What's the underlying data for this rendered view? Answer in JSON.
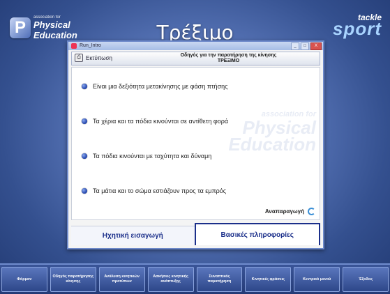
{
  "header": {
    "logo_left": {
      "line1": "association for",
      "line2": "Physical",
      "line3": "Education"
    },
    "title": "Τρέξιμο",
    "logo_right": {
      "line1": "tackle",
      "line2": "sport"
    }
  },
  "window": {
    "title": "Run_Intro",
    "buttons": {
      "minimize": "_",
      "maximize": "□",
      "close": "X"
    },
    "toolbar": {
      "print_label": "Εκτύπωση",
      "doc_title_line1": "Οδηγός για την παρατήρηση της κίνησης",
      "doc_title_line2": "ΤΡΕΞΙΜΟ"
    },
    "watermark": {
      "line1": "association for",
      "line2": "Physical",
      "line3": "Education"
    },
    "bullets": [
      "Είναι μια δεξιότητα μετακίνησης με φάση πτήσης",
      "Τα χέρια και τα πόδια κινούνται σε αντίθετη φορά",
      "Τα πόδια κινούνται με ταχύτητα και δύναμη",
      "Τα μάτια και το σώμα εστιάζουν προς τα εμπρός"
    ],
    "replay_label": "Αναπαραγωγή",
    "tabs": [
      {
        "label": "Ηχητική εισαγωγή",
        "active": false
      },
      {
        "label": "Βασικές πληροφορίες",
        "active": true
      }
    ]
  },
  "nav": [
    "Φόρμαν",
    "Οδηγός παρατήρησης κίνησης",
    "Ανάλυση κινητικών προτύπων",
    "Ασκήσεις κινητικής ανάπτυξης",
    "Συνοπτικός παρατήρηση",
    "Κινητικές φράσεις",
    "Κεντρικό μενού",
    "Έξοδος"
  ],
  "colors": {
    "accent": "#1b2f8a",
    "background": "#4a66aa"
  }
}
